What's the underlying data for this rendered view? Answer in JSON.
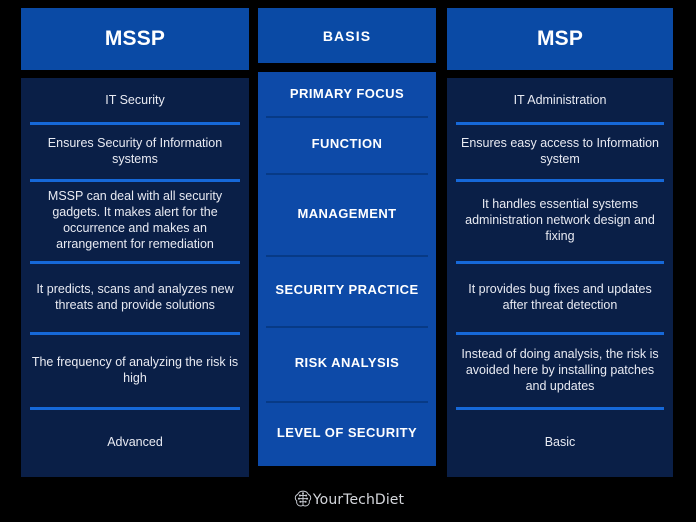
{
  "background_color": "#000000",
  "accent_blue": "#0a4aa5",
  "panel_navy": "#0a1f47",
  "divider_blue": "#1668d8",
  "divider_navy": "#073a86",
  "columns": {
    "left": {
      "header": "MSSP",
      "rows": [
        "IT Security",
        "Ensures Security of Information systems",
        "MSSP can deal with all security gadgets. It makes alert for the occurrence and makes an arrangement for remediation",
        "It predicts, scans and analyzes new threats and provide solutions",
        "The frequency of analyzing the risk is high",
        "Advanced"
      ]
    },
    "middle": {
      "header": "BASIS",
      "rows": [
        "PRIMARY FOCUS",
        "FUNCTION",
        "MANAGEMENT",
        "SECURITY PRACTICE",
        "RISK ANALYSIS",
        "LEVEL OF SECURITY"
      ]
    },
    "right": {
      "header": "MSP",
      "rows": [
        "IT Administration",
        "Ensures easy access to Information system",
        "It handles essential systems administration network design and fixing",
        "It provides bug fixes and updates after threat detection",
        "Instead of doing analysis, the risk is avoided here by installing patches and updates",
        "Basic"
      ]
    }
  },
  "footer": {
    "brand_name": "YourTechDiet",
    "brand_icon": "brain-circuit-icon"
  }
}
